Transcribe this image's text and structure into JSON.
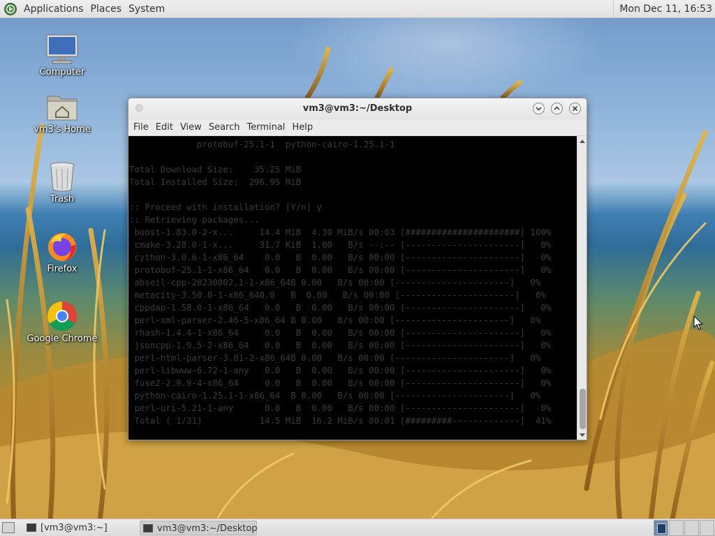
{
  "top_panel": {
    "menus": [
      "Applications",
      "Places",
      "System"
    ],
    "clock": "Mon Dec 11, 16:53"
  },
  "desktop": {
    "icons": [
      {
        "label": "Computer",
        "icon": "computer-icon"
      },
      {
        "label": "vm3's Home",
        "icon": "home-folder-icon"
      },
      {
        "label": "Trash",
        "icon": "trash-icon"
      },
      {
        "label": "Firefox",
        "icon": "firefox-icon"
      },
      {
        "label": "Google Chrome",
        "icon": "chrome-icon"
      }
    ]
  },
  "terminal": {
    "title": "vm3@vm3:~/Desktop",
    "menu": [
      "File",
      "Edit",
      "View",
      "Search",
      "Terminal",
      "Help"
    ],
    "lines": [
      "             protobuf-25.1-1  python-cairo-1.25.1-1",
      "",
      "Total Download Size:    35.25 MiB",
      "Total Installed Size:  296.95 MiB",
      "",
      ":: Proceed with installation? [Y/n] y",
      ":: Retrieving packages...",
      " boost-1.83.0-2-x...     14.4 MiB  4.30 MiB/s 00:03 [######################] 100%",
      " cmake-3.28.0-1-x...     31.7 KiB  1.00   B/s --:-- [----------------------]   0%",
      " cython-3.0.6-1-x86_64    0.0   B  0.00   B/s 00:00 [----------------------]   0%",
      " protobuf-25.1-1-x86_64   0.0   B  0.00   B/s 00:00 [----------------------]   0%",
      " abseil-cpp-20230802.1-1-x86_64B 0.00   B/s 00:00 [----------------------]   0%",
      " metacity-3.50.0-1-x86_640.0   B  0.00   B/s 00:00 [----------------------]   0%",
      " cppdap-1.58.0-1-x86_64   0.0   B  0.00   B/s 00:00 [----------------------]   0%",
      " perl-xml-parser-2.46-5-x86_64 B 0.00   B/s 00:00 [----------------------]   0%",
      " rhash-1.4.4-1-x86_64     0.0   B  0.00   B/s 00:00 [----------------------]   0%",
      " jsoncpp-1.9.5-2-x86_64   0.0   B  0.00   B/s 00:00 [----------------------]   0%",
      " perl-html-parser-3.81-2-x86_64B 0.00   B/s 00:00 [----------------------]   0%",
      " perl-libwww-6.72-1-any   0.0   B  0.00   B/s 00:00 [----------------------]   0%",
      " fuse2-2.9.9-4-x86_64     0.0   B  0.00   B/s 00:00 [----------------------]   0%",
      " python-cairo-1.25.1-1-x86_64  B 0.00   B/s 00:00 [----------------------]   0%",
      " perl-uri-5.21-1-any      0.0   B  0.00   B/s 00:00 [----------------------]   0%",
      " Total ( 1/31)           14.5 MiB  16.2 MiB/s 00:01 [#########-------------]  41%"
    ]
  },
  "taskbar": {
    "tasks": [
      {
        "label": "[vm3@vm3:~]"
      },
      {
        "label": "vm3@vm3:~/Desktop"
      }
    ]
  }
}
